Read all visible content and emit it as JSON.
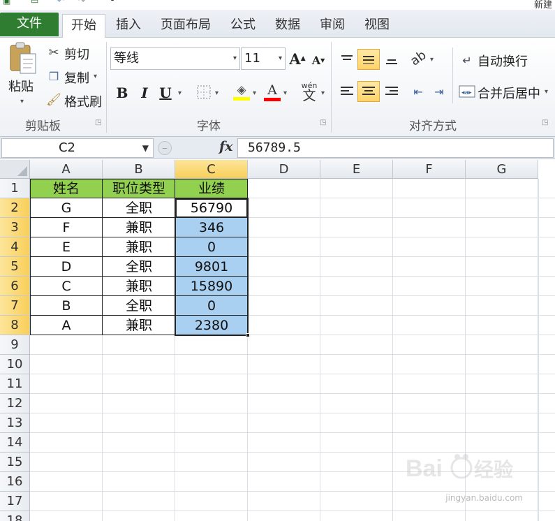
{
  "window": {
    "title_partial": "新建"
  },
  "ribbon_tabs": [
    "文件",
    "开始",
    "插入",
    "页面布局",
    "公式",
    "数据",
    "审阅",
    "视图"
  ],
  "clipboard": {
    "paste": "粘贴",
    "cut": "剪切",
    "copy": "复制",
    "format_painter": "格式刷",
    "group": "剪贴板"
  },
  "font": {
    "name": "等线",
    "size": "11",
    "bold": "B",
    "italic": "I",
    "underline": "U",
    "font_color_letter": "A",
    "phonetic": "wén",
    "phonetic_char": "文",
    "group": "字体"
  },
  "alignment": {
    "wrap_text": "自动换行",
    "merge_center": "合并后居中",
    "group": "对齐方式"
  },
  "formula_bar": {
    "name_box": "C2",
    "fx": "fx",
    "value": "56789.5"
  },
  "columns": [
    "A",
    "B",
    "C",
    "D",
    "E",
    "F",
    "G"
  ],
  "rows": [
    "1",
    "2",
    "3",
    "4",
    "5",
    "6",
    "7",
    "8",
    "9",
    "10",
    "11",
    "12",
    "13",
    "14",
    "15",
    "16",
    "17",
    "18"
  ],
  "table": {
    "headers": [
      "姓名",
      "职位类型",
      "业绩"
    ],
    "rows": [
      [
        "G",
        "全职",
        "56790"
      ],
      [
        "F",
        "兼职",
        "346"
      ],
      [
        "E",
        "兼职",
        "0"
      ],
      [
        "D",
        "全职",
        "9801"
      ],
      [
        "C",
        "兼职",
        "15890"
      ],
      [
        "B",
        "全职",
        "0"
      ],
      [
        "A",
        "兼职",
        "2380"
      ]
    ]
  },
  "colors": {
    "file_tab": "#2f7d31",
    "header_fill": "#92d050",
    "selection_fill": "#a9d0f0",
    "selected_header": "#f8cf5a"
  },
  "watermark": {
    "url": "jingyan.baidu.com"
  }
}
